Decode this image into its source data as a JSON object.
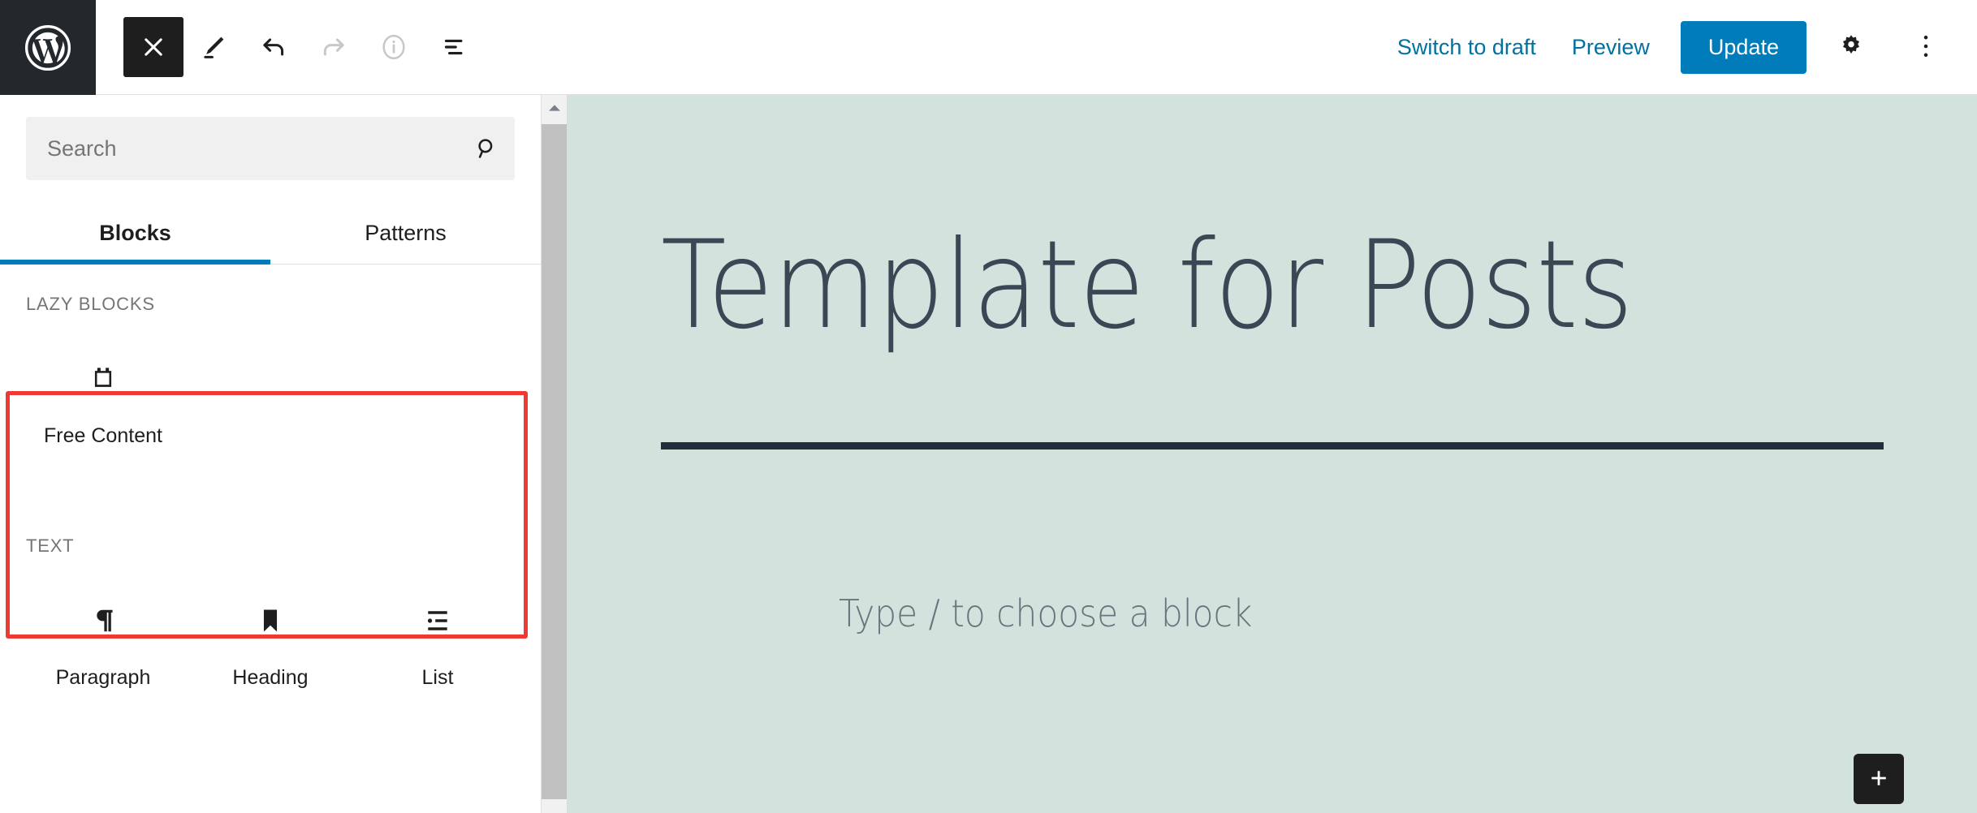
{
  "toolbar": {
    "logo_icon": "wordpress-logo-icon",
    "left_buttons": [
      {
        "name": "close-inserter-button",
        "icon": "close-icon",
        "label": "Close block inserter",
        "state": "active"
      },
      {
        "name": "tools-button",
        "icon": "pencil-icon",
        "label": "Tools",
        "state": "default"
      },
      {
        "name": "undo-button",
        "icon": "undo-icon",
        "label": "Undo",
        "state": "default"
      },
      {
        "name": "redo-button",
        "icon": "redo-icon",
        "label": "Redo",
        "state": "disabled"
      },
      {
        "name": "details-button",
        "icon": "info-icon",
        "label": "Details",
        "state": "disabled"
      },
      {
        "name": "list-view-button",
        "icon": "list-view-icon",
        "label": "List View",
        "state": "default"
      }
    ],
    "switch_to_draft_label": "Switch to draft",
    "preview_label": "Preview",
    "update_label": "Update",
    "settings_icon": "gear-icon",
    "options_icon": "more-vertical-icon",
    "accent_color": "#007cba",
    "link_color": "#0071a1",
    "logo_background": "#23282d"
  },
  "inserter": {
    "search": {
      "placeholder": "Search",
      "value": "",
      "icon": "search-icon"
    },
    "tabs": [
      {
        "label": "Blocks",
        "active": true
      },
      {
        "label": "Patterns",
        "active": false
      }
    ],
    "sections": [
      {
        "title": "LAZY BLOCKS",
        "highlighted": true,
        "blocks": [
          {
            "label": "Free Content",
            "icon": "block-brick-icon"
          }
        ]
      },
      {
        "title": "TEXT",
        "highlighted": false,
        "blocks": [
          {
            "label": "Paragraph",
            "icon": "pilcrow-icon"
          },
          {
            "label": "Heading",
            "icon": "bookmark-icon"
          },
          {
            "label": "List",
            "icon": "bulleted-list-icon"
          }
        ]
      }
    ],
    "annotation_color": "#ee3a32",
    "scrollbar": {
      "up_arrow_icon": "chevron-up-icon",
      "thumb_name": "scrollbar-thumb"
    }
  },
  "canvas": {
    "background_color": "#d2e2dc",
    "post_title": "Template for Posts",
    "block_placeholder": "Type / to choose a block",
    "add_block_icon": "plus-icon",
    "add_block_label": "Add block"
  }
}
